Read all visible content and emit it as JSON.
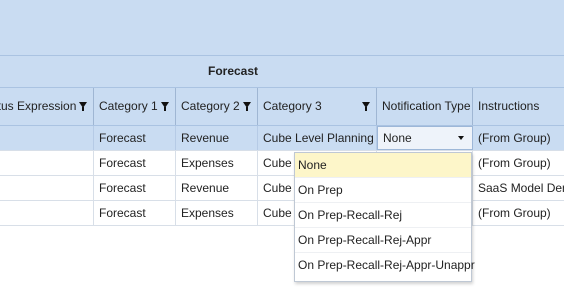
{
  "group_header": {
    "title": "Forecast"
  },
  "columns": [
    {
      "label": "atus Expression",
      "filter": true
    },
    {
      "label": "Category 1",
      "filter": true
    },
    {
      "label": "Category 2",
      "filter": true
    },
    {
      "label": "Category 3",
      "filter": true
    },
    {
      "label": "Notification Type",
      "filter": false
    },
    {
      "label": "Instructions",
      "filter": false
    }
  ],
  "rows": [
    {
      "status": "",
      "cat1": "Forecast",
      "cat2": "Revenue",
      "cat3": "Cube Level Planning",
      "notification": "None",
      "instructions": "(From Group)",
      "selected": true
    },
    {
      "status": "",
      "cat1": "Forecast",
      "cat2": "Expenses",
      "cat3": "Cube Level Planning",
      "notification": "",
      "instructions": "(From Group)",
      "selected": false
    },
    {
      "status": "",
      "cat1": "Forecast",
      "cat2": "Revenue",
      "cat3": "Cube Level Planning",
      "notification": "",
      "instructions": "SaaS Model Dem",
      "selected": false
    },
    {
      "status": "",
      "cat1": "Forecast",
      "cat2": "Expenses",
      "cat3": "Cube Level Planning",
      "notification": "",
      "instructions": "(From Group)",
      "selected": false
    }
  ],
  "notification_dropdown": {
    "selected": "None",
    "options": [
      "None",
      "On Prep",
      "On Prep-Recall-Rej",
      "On Prep-Recall-Rej-Appr",
      "On Prep-Recall-Rej-Appr-Unappr"
    ],
    "highlighted_index": 0
  },
  "colors": {
    "header_bg": "#c9dcf2",
    "selected_row_bg": "#c9dcf2",
    "highlight_option_bg": "#fdf6c9"
  }
}
